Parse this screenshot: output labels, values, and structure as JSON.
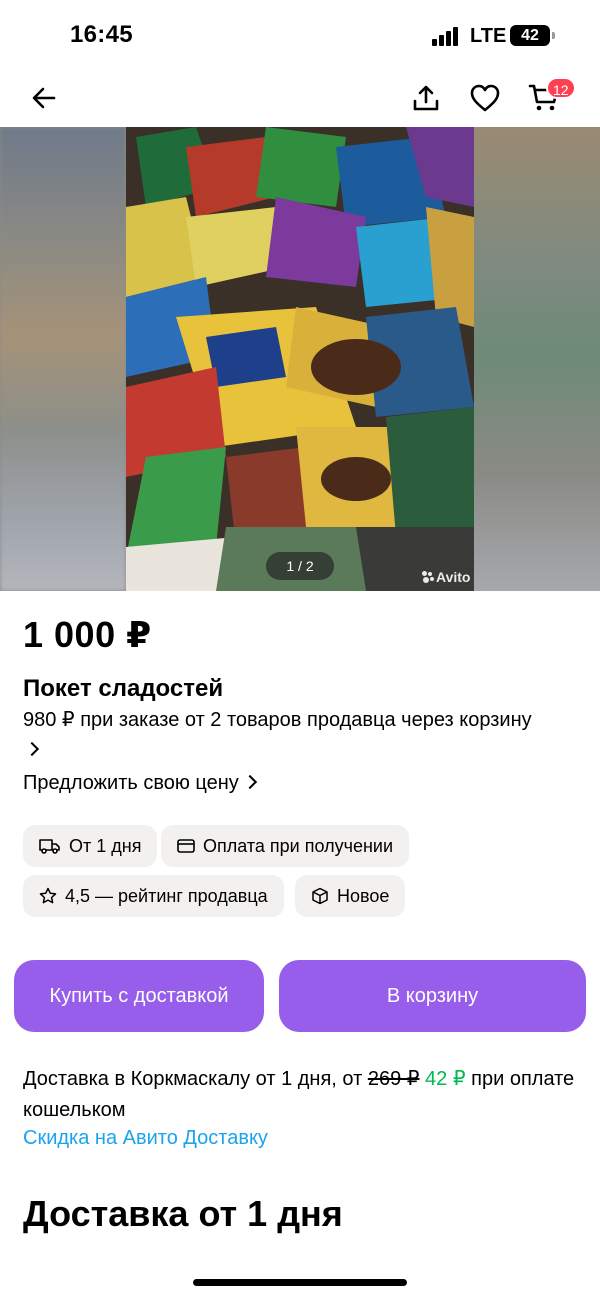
{
  "status_bar": {
    "time": "16:45",
    "network": "LTE",
    "battery": "42"
  },
  "nav": {
    "cart_count": "12",
    "icons": [
      "arrow-left-icon",
      "share-icon",
      "heart-icon",
      "cart-icon"
    ]
  },
  "gallery": {
    "counter": "1 / 2",
    "watermark": "Avito"
  },
  "listing": {
    "price": "1 000 ₽",
    "title": "Покет сладостей",
    "cart_offer": "980 ₽ при заказе от 2 товаров продавца через корзину",
    "offer_price_link": "Предложить свою цену"
  },
  "chips": {
    "delivery": "От 1 дня",
    "payment": "Оплата при получении",
    "rating": "4,5 — рейтинг продавца",
    "condition": "Новое"
  },
  "actions": {
    "buy_with_delivery": "Купить с доставкой",
    "add_to_cart": "В корзину"
  },
  "delivery": {
    "text_before": "Доставка в Коркмаскалу от 1 дня, от ",
    "old_price": "269 ₽",
    "new_price": "42 ₽",
    "text_after": " при оплате кошельком",
    "discount_link": "Скидка на Авито Доставку",
    "section_title": "Доставка от 1 дня"
  },
  "colors": {
    "accent": "#965eeb",
    "badge": "#ff4053",
    "link": "#1aa3f0",
    "discount": "#02b851",
    "chip_bg": "#f2f1f0"
  }
}
